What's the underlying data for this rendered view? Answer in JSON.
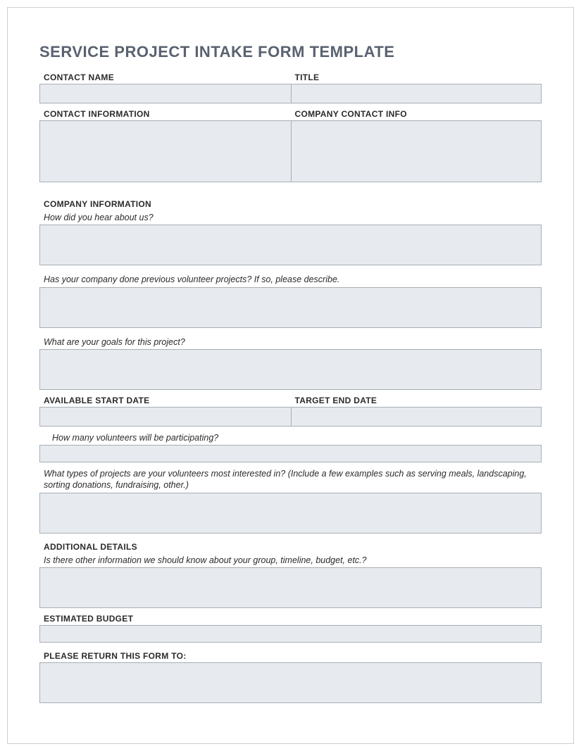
{
  "title": "SERVICE PROJECT INTAKE FORM TEMPLATE",
  "labels": {
    "contact_name": "CONTACT NAME",
    "title_field": "TITLE",
    "contact_info": "CONTACT INFORMATION",
    "company_contact_info": "COMPANY CONTACT INFO",
    "company_info": "COMPANY INFORMATION",
    "hear_about": "How did you hear about us?",
    "previous_projects": "Has your company done previous volunteer projects? If so, please describe.",
    "goals": "What are your goals for this project?",
    "start_date": "AVAILABLE START DATE",
    "end_date": "TARGET END DATE",
    "volunteers": "How many volunteers will be participating?",
    "project_types": "What types of projects are your volunteers most interested in? (Include a few examples such as serving meals, landscaping, sorting donations, fundraising, other.)",
    "additional_details": "ADDITIONAL DETAILS",
    "other_info": "Is there other information we should know about your group, timeline, budget, etc.?",
    "budget": "ESTIMATED BUDGET",
    "return_to": "PLEASE RETURN THIS FORM TO:"
  }
}
